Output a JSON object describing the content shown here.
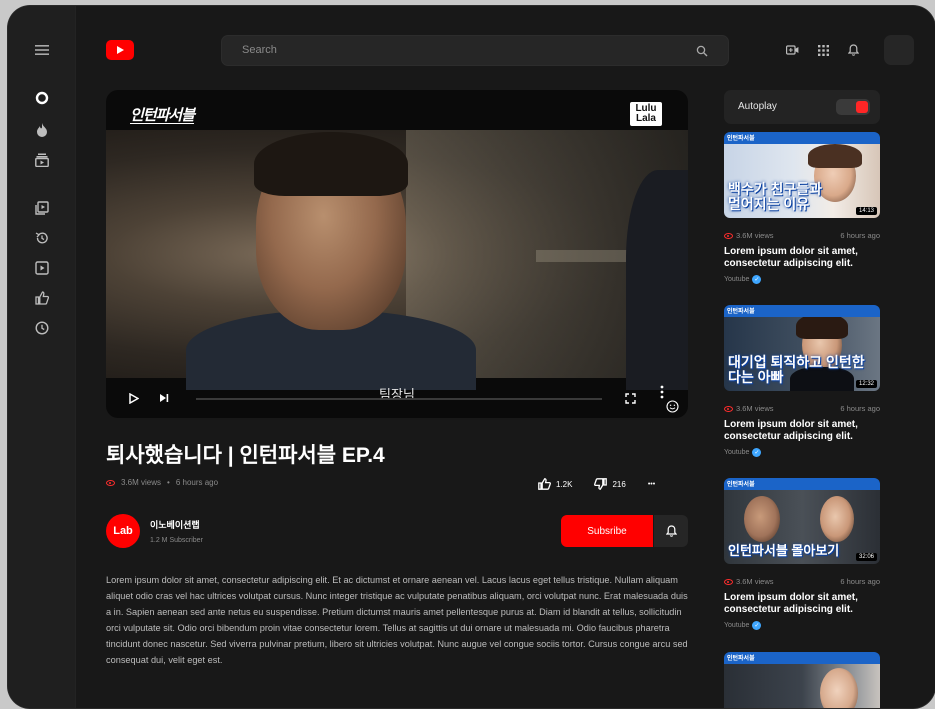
{
  "header": {
    "search_placeholder": "Search"
  },
  "player": {
    "show_title": "인턴파서블",
    "channel_badge": "Lulu Lala",
    "subtitle": "팀장님",
    "progress": 0.0
  },
  "video": {
    "title": "퇴사했습니다 | 인턴파서블 EP.4",
    "views": "3.6M views",
    "separator": "•",
    "time": "6 hours ago",
    "likes": "1.2K",
    "dislikes": "216",
    "more": "•••"
  },
  "channel": {
    "logo_text": "Lab",
    "name": "이노베이션랩",
    "subscribers": "1.2 M Subscriber",
    "subscribe_label": "Subsribe"
  },
  "description": "Lorem ipsum dolor sit amet, consectetur adipiscing elit. Et ac dictumst et ornare aenean vel. Lacus lacus eget tellus tristique. Nullam aliquam aliquet odio cras vel hac ultrices volutpat cursus. Nunc integer tristique ac vulputate penatibus aliquam, orci volutpat nunc. Erat malesuada duis a in. Sapien aenean sed ante netus eu suspendisse. Pretium dictumst mauris amet pellentesque purus at. Diam id blandit at tellus, sollicitudin orci vulputate sit. Odio orci bibendum proin vitae consectetur lorem. Tellus at sagittis ut dui ornare ut malesuada mi. Odio faucibus pharetra tincidunt donec nascetur. Sed viverra pulvinar pretium, libero sit ultricies volutpat. Nunc augue vel congue sociis tortor. Cursus congue arcu sed consequat dui, velit eget est.",
  "autoplay": {
    "label": "Autoplay",
    "on": true
  },
  "recommendations": [
    {
      "thumb_bar": "인턴파서블",
      "thumb_text": "백수가 친구들과 멀어지는 이유",
      "duration": "14:13",
      "views": "3.6M views",
      "time": "6 hours ago",
      "title": "Lorem ipsum dolor sit amet, consectetur adipiscing elit.",
      "channel": "Youtube"
    },
    {
      "thumb_bar": "인턴파서블",
      "thumb_text": "대기업 퇴직하고 인턴한다는 아빠",
      "duration": "12:32",
      "views": "3.6M views",
      "time": "6 hours ago",
      "title": "Lorem ipsum dolor sit amet, consectetur adipiscing elit.",
      "channel": "Youtube"
    },
    {
      "thumb_bar": "인턴파서블",
      "thumb_text": "인턴파서블 몰아보기",
      "duration": "32:06",
      "views": "3.6M views",
      "time": "6 hours ago",
      "title": "Lorem ipsum dolor sit amet, consectetur adipiscing elit.",
      "channel": "Youtube"
    },
    {
      "thumb_bar": "인턴파서블",
      "thumb_text": "",
      "duration": "",
      "views": "",
      "time": "",
      "title": "",
      "channel": ""
    }
  ],
  "colors": {
    "accent": "#ff0000",
    "background": "#181818",
    "rail": "#1f1f1f",
    "verified": "#3ea6ff"
  }
}
